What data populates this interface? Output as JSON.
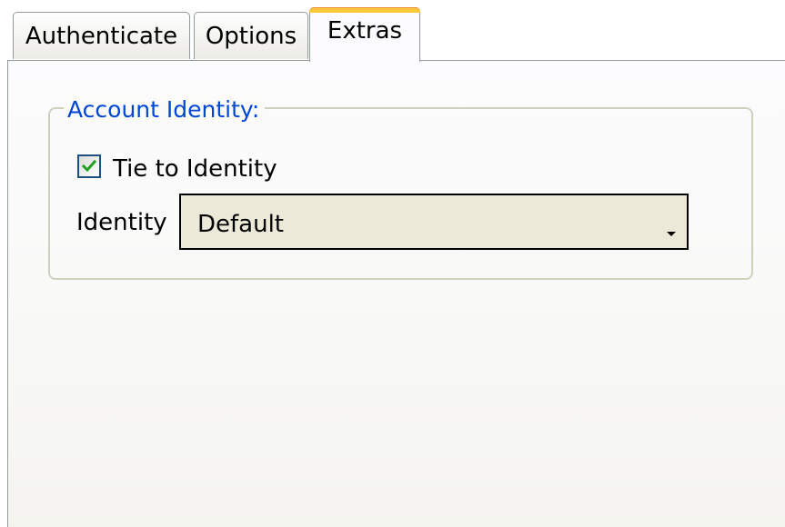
{
  "tabs": [
    {
      "label": "Authenticate",
      "selected": false
    },
    {
      "label": "Options",
      "selected": false
    },
    {
      "label": "Extras",
      "selected": true
    }
  ],
  "account_identity": {
    "title": "Account Identity:",
    "tie_checkbox": {
      "label": "Tie to Identity",
      "checked": true
    },
    "identity": {
      "label": "Identity",
      "value": "Default"
    }
  },
  "colors": {
    "group_title": "#0046d5",
    "selected_tab_accent": "#ffc83c",
    "checkmark": "#21a121",
    "select_background": "#ece9d8"
  }
}
